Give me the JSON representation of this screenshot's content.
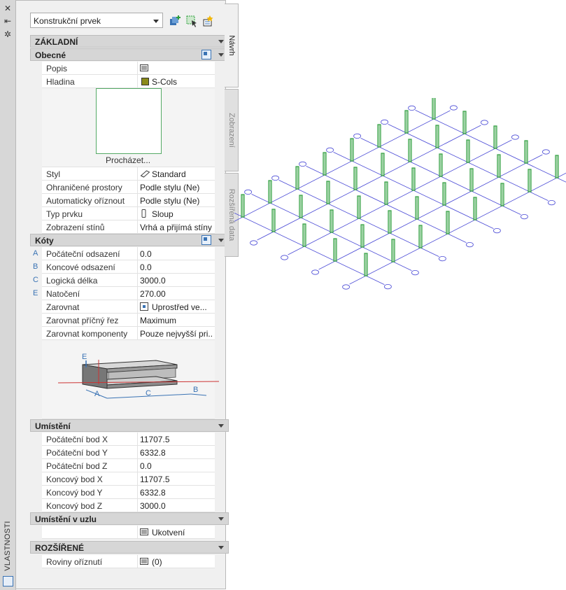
{
  "palette": {
    "title": "VLASTNOSTI"
  },
  "object_type": {
    "selected": "Konstrukční prvek"
  },
  "tabs": [
    {
      "label": "Návrh",
      "active": true
    },
    {
      "label": "Zobrazení",
      "active": false
    },
    {
      "label": "Rozšířená data",
      "active": false
    }
  ],
  "sections": {
    "zakladni": "ZÁKLADNÍ",
    "obecne": "Obecné",
    "koty": "Kóty",
    "umisteni": "Umístění",
    "umisteni_uzel": "Umístění v uzlu",
    "rozsirene": "ROZŠÍŘENÉ"
  },
  "general": {
    "popis": {
      "label": "Popis",
      "value": ""
    },
    "hladina": {
      "label": "Hladina",
      "value": "S-Cols"
    },
    "browse": "Procházet...",
    "styl": {
      "label": "Styl",
      "value": "Standard"
    },
    "ohranicene": {
      "label": "Ohraničené prostory",
      "value": "Podle stylu (Ne)"
    },
    "oriznout": {
      "label": "Automaticky oříznout",
      "value": "Podle stylu (Ne)"
    },
    "typ": {
      "label": "Typ prvku",
      "value": "Sloup"
    },
    "stiny": {
      "label": "Zobrazení stínů",
      "value": "Vrhá a přijímá stíny"
    }
  },
  "dimensions": {
    "rows": [
      {
        "letter": "A",
        "label": "Počáteční odsazení",
        "value": "0.0"
      },
      {
        "letter": "B",
        "label": "Koncové odsazení",
        "value": "0.0"
      },
      {
        "letter": "C",
        "label": "Logická délka",
        "value": "3000.0"
      },
      {
        "letter": "E",
        "label": "Natočení",
        "value": "270.00"
      },
      {
        "letter": "",
        "label": "Zarovnat",
        "value": "Uprostřed ve..."
      },
      {
        "letter": "",
        "label": "Zarovnat příčný řez",
        "value": "Maximum"
      },
      {
        "letter": "",
        "label": "Zarovnat komponenty",
        "value": "Pouze nejvyšší pri..."
      }
    ],
    "diagram_letters": {
      "a": "A",
      "b": "B",
      "c": "C",
      "e": "E"
    }
  },
  "location": {
    "rows": [
      {
        "label": "Počáteční bod X",
        "value": "11707.5"
      },
      {
        "label": "Počáteční bod Y",
        "value": "6332.8"
      },
      {
        "label": "Počáteční bod Z",
        "value": "0.0"
      },
      {
        "label": "Koncový bod X",
        "value": "11707.5"
      },
      {
        "label": "Koncový bod Y",
        "value": "6332.8"
      },
      {
        "label": "Koncový bod Z",
        "value": "3000.0"
      }
    ]
  },
  "node": {
    "anchor": "Ukotvení"
  },
  "extended": {
    "label": "Roviny oříznutí",
    "value": "(0)"
  },
  "colors": {
    "accent": "#3a73b4",
    "column_green": "#2e9e3e",
    "grid_blue": "#4a4ad6"
  }
}
